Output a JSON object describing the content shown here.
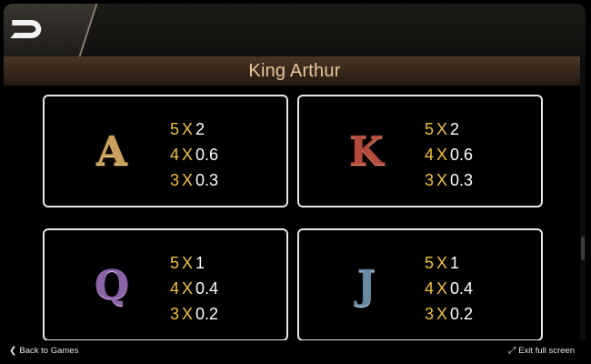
{
  "header": {
    "title": "King Arthur"
  },
  "paytable": [
    {
      "symbol": "A",
      "symbol_icon": "letter-a-symbol-icon",
      "color": "#c9a05a",
      "pays": [
        {
          "count": "5",
          "x": "X",
          "value": "2"
        },
        {
          "count": "4",
          "x": "X",
          "value": "0.6"
        },
        {
          "count": "3",
          "x": "X",
          "value": "0.3"
        }
      ]
    },
    {
      "symbol": "K",
      "symbol_icon": "letter-k-symbol-icon",
      "color": "#b34a3a",
      "pays": [
        {
          "count": "5",
          "x": "X",
          "value": "2"
        },
        {
          "count": "4",
          "x": "X",
          "value": "0.6"
        },
        {
          "count": "3",
          "x": "X",
          "value": "0.3"
        }
      ]
    },
    {
      "symbol": "Q",
      "symbol_icon": "letter-q-symbol-icon",
      "color": "#8a63a8",
      "pays": [
        {
          "count": "5",
          "x": "X",
          "value": "1"
        },
        {
          "count": "4",
          "x": "X",
          "value": "0.4"
        },
        {
          "count": "3",
          "x": "X",
          "value": "0.2"
        }
      ]
    },
    {
      "symbol": "J",
      "symbol_icon": "letter-j-symbol-icon",
      "color": "#6a8aa3",
      "pays": [
        {
          "count": "5",
          "x": "X",
          "value": "1"
        },
        {
          "count": "4",
          "x": "X",
          "value": "0.4"
        },
        {
          "count": "3",
          "x": "X",
          "value": "0.2"
        }
      ]
    }
  ],
  "footer": {
    "back_label": "Back to Games",
    "back_icon": "chevron-left-icon",
    "exit_label": "Exit full screen",
    "exit_icon": "collapse-arrows-icon"
  },
  "colors": {
    "accent": "#f2c040",
    "title": "#e9c79b"
  }
}
